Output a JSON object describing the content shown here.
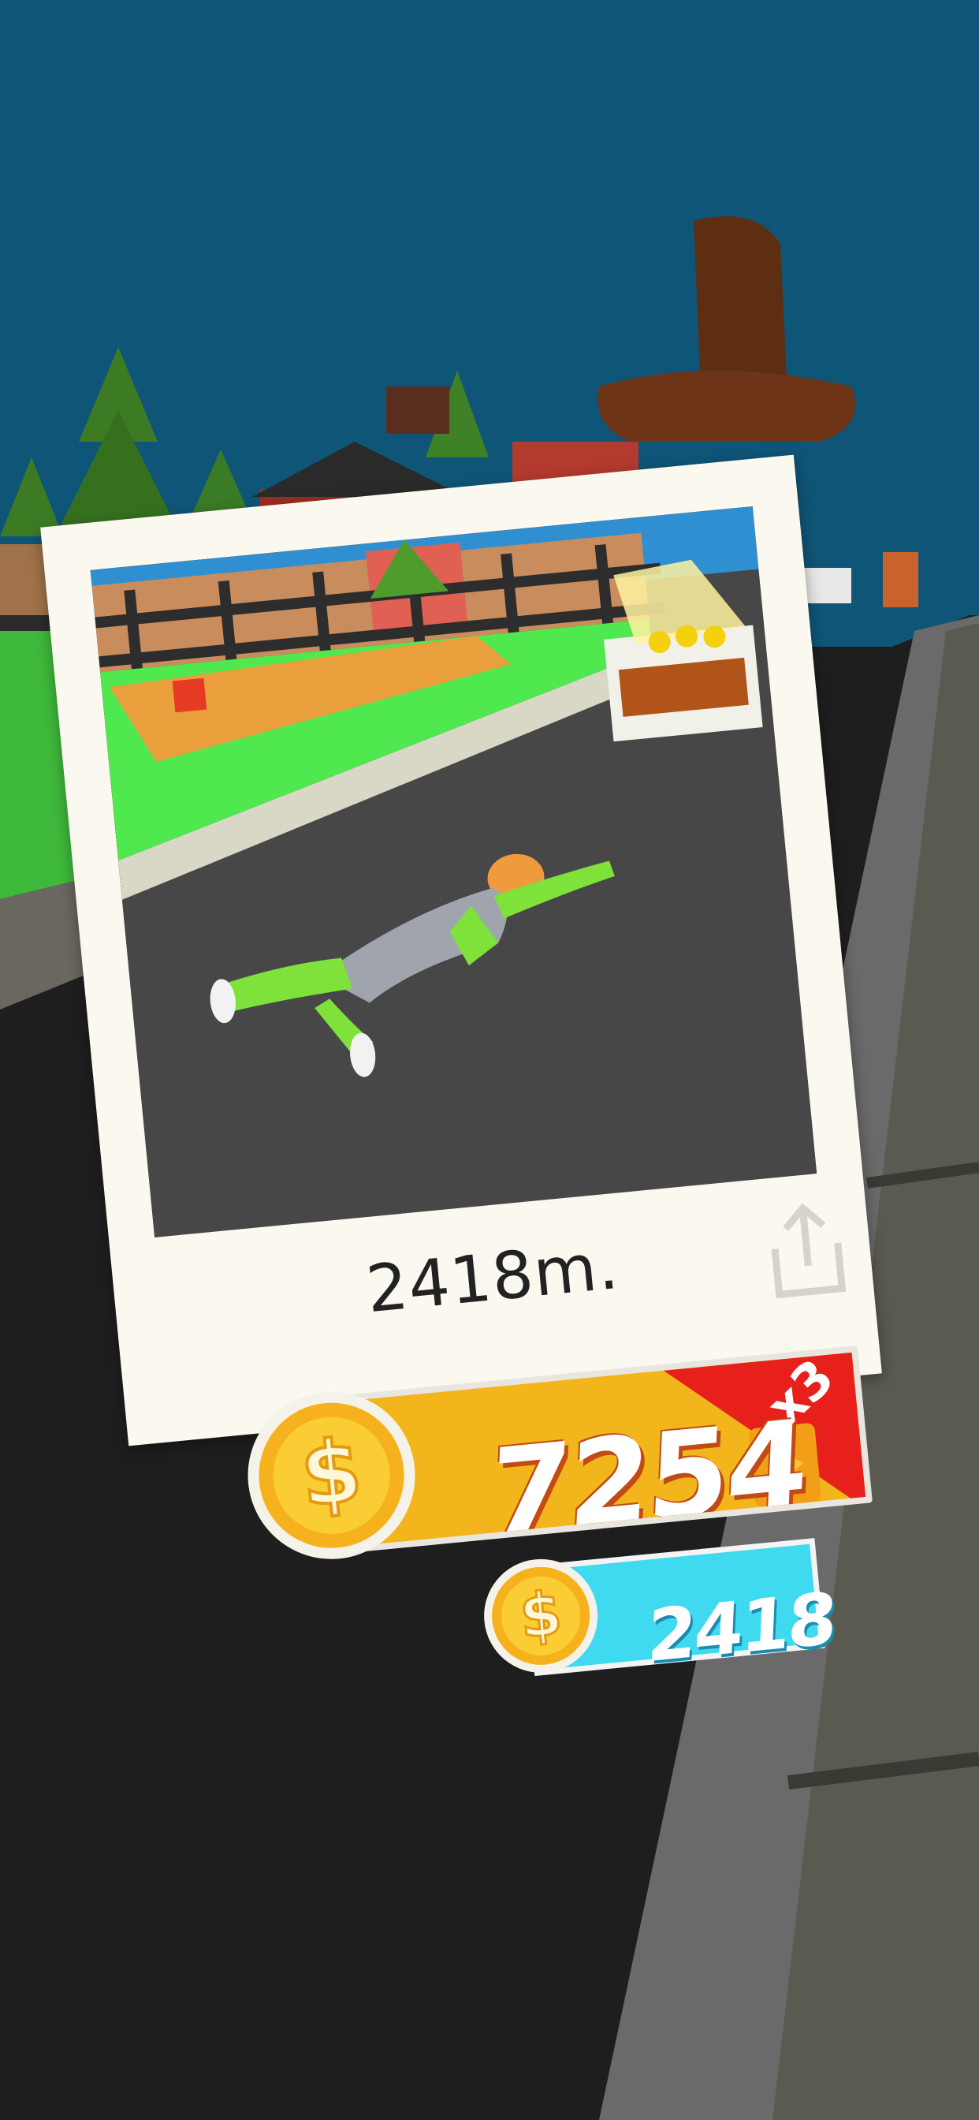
{
  "result": {
    "distance_label": "2418m."
  },
  "rewards": {
    "multiplied": {
      "amount": "7254",
      "multiplier_label": "x3",
      "ad_icon": "play-video-icon"
    },
    "base": {
      "amount": "2418"
    }
  },
  "icons": {
    "share": "share-icon",
    "coin": "dollar-coin-icon"
  },
  "colors": {
    "sky": "#0f5577",
    "road": "#1e1e1e",
    "reward_gold": "#f2b51b",
    "multiplier_red": "#e8201c",
    "base_cyan": "#3fdaf0",
    "ragdoll_green": "#7ee23a"
  }
}
